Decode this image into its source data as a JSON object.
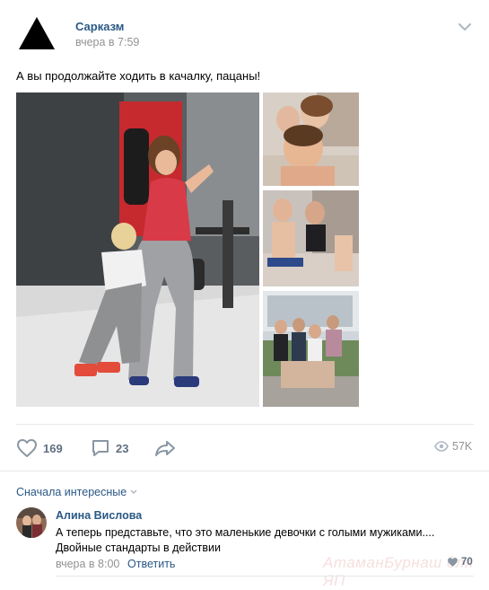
{
  "post": {
    "author": "Сарказм",
    "time": "вчера в 7:59",
    "text": "А вы продолжайте ходить в качалку, пацаны!"
  },
  "actions": {
    "likes": "169",
    "comments": "23",
    "views": "57K"
  },
  "comments_section": {
    "sort_label": "Сначала интересные",
    "items": [
      {
        "author": "Алина Вислова",
        "text": "А теперь представьте, что это маленькие девочки с голыми мужиками.... Двойные стандарты в действии",
        "time": "вчера в 8:00",
        "reply_label": "Ответить",
        "likes": "70"
      }
    ]
  },
  "watermark": "АтаманБурнаш для ЯП",
  "icons": {
    "avatar": "black-triangle-logo",
    "menu": "chevron-down-icon",
    "like": "heart-icon",
    "comment": "comment-icon",
    "share": "share-icon",
    "views": "eye-icon"
  },
  "colors": {
    "link": "#2a5885",
    "muted": "#939393",
    "action": "#8996a3",
    "divider": "#e7e8ec"
  }
}
